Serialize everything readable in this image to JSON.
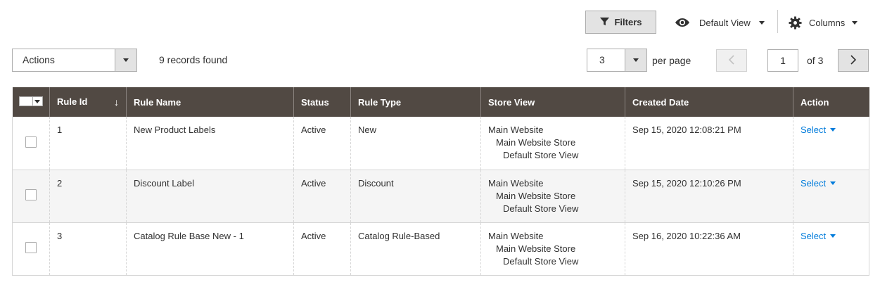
{
  "toolbar": {
    "filters_label": "Filters",
    "view_label": "Default View",
    "columns_label": "Columns"
  },
  "actions": {
    "selected": "Actions",
    "records_found": "9 records found"
  },
  "pager": {
    "per_page_value": "3",
    "per_page_label": "per page",
    "current_page": "1",
    "of_label": "of 3"
  },
  "grid": {
    "columns": [
      "Rule Id",
      "Rule Name",
      "Status",
      "Rule Type",
      "Store View",
      "Created Date",
      "Action"
    ],
    "rows": [
      {
        "id": "1",
        "name": "New Product Labels",
        "status": "Active",
        "type": "New",
        "store_view": [
          "Main Website",
          "Main Website Store",
          "Default Store View"
        ],
        "created": "Sep 15, 2020 12:08:21 PM",
        "action": "Select"
      },
      {
        "id": "2",
        "name": "Discount Label",
        "status": "Active",
        "type": "Discount",
        "store_view": [
          "Main Website",
          "Main Website Store",
          "Default Store View"
        ],
        "created": "Sep 15, 2020 12:10:26 PM",
        "action": "Select"
      },
      {
        "id": "3",
        "name": "Catalog Rule Base New - 1",
        "status": "Active",
        "type": "Catalog Rule-Based",
        "store_view": [
          "Main Website",
          "Main Website Store",
          "Default Store View"
        ],
        "created": "Sep 16, 2020 10:22:36 AM",
        "action": "Select"
      }
    ]
  },
  "colors": {
    "header_bg": "#514943",
    "link": "#007bdb",
    "button_bg": "#e3e3e3",
    "row_alt_bg": "#f5f5f5"
  },
  "icons": [
    "filter-icon",
    "eye-icon",
    "gear-icon",
    "chevron-down-icon",
    "chevron-left-icon",
    "chevron-right-icon",
    "sort-arrow-icon"
  ]
}
